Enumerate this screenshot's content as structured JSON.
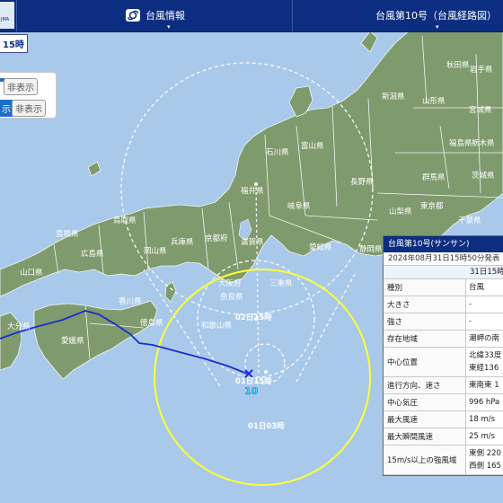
{
  "header": {
    "nav_center": "台風情報",
    "nav_right": "台風第10号（台風経路図）",
    "caret": "▾",
    "logo_text": "JMA"
  },
  "controls": {
    "time_label": "15時",
    "row1_hide": "非表示",
    "row2_show": "示",
    "row2_hide": "非表示"
  },
  "map": {
    "colors": {
      "sea": "#a9c9ea",
      "land": "#7f9b6d",
      "border": "#f4f4f4",
      "track": "#1b2fd0",
      "storm_circle": "#ffff33",
      "forecast": "#ffffff"
    },
    "storm_number": "10",
    "forecast_labels": [
      "02日15時",
      "01日15時",
      "01日03時"
    ],
    "prefectures": [
      "秋田県",
      "岩手県",
      "山形県",
      "宮城県",
      "福島県",
      "新潟県",
      "栃木県",
      "茨城県",
      "富山県",
      "群馬県",
      "長野県",
      "石川県",
      "福井県",
      "岐阜県",
      "山梨県",
      "東京都",
      "千葉県",
      "京都府",
      "兵庫県",
      "滋賀県",
      "愛知県",
      "静岡県",
      "鳥取県",
      "岡山県",
      "島根県",
      "広島県",
      "山口県",
      "大阪府",
      "奈良県",
      "三重県",
      "香川県",
      "和歌山県",
      "徳島県",
      "愛媛県",
      "大分県"
    ]
  },
  "info_panel": {
    "title": "台風第10号(サンサン)",
    "issued": "2024年08月31日15時50分発表",
    "observed": "31日15時の実",
    "rows": [
      {
        "key": "種別",
        "values": [
          "台風"
        ]
      },
      {
        "key": "大きさ",
        "values": [
          "-"
        ]
      },
      {
        "key": "強さ",
        "values": [
          "-"
        ]
      },
      {
        "key": "存在地域",
        "values": [
          "潮岬の南"
        ]
      },
      {
        "key": "中心位置",
        "values": [
          "北緯33度",
          "東経136"
        ]
      },
      {
        "key": "進行方向、速さ",
        "values": [
          "東南東 1"
        ]
      },
      {
        "key": "中心気圧",
        "values": [
          "996 hPa"
        ]
      },
      {
        "key": "最大風速",
        "values": [
          "18 m/s"
        ]
      },
      {
        "key": "最大瞬間風速",
        "values": [
          "25 m/s"
        ]
      },
      {
        "key": "15m/s以上の強風域",
        "values": [
          "東側 220",
          "西側 165"
        ]
      }
    ]
  }
}
